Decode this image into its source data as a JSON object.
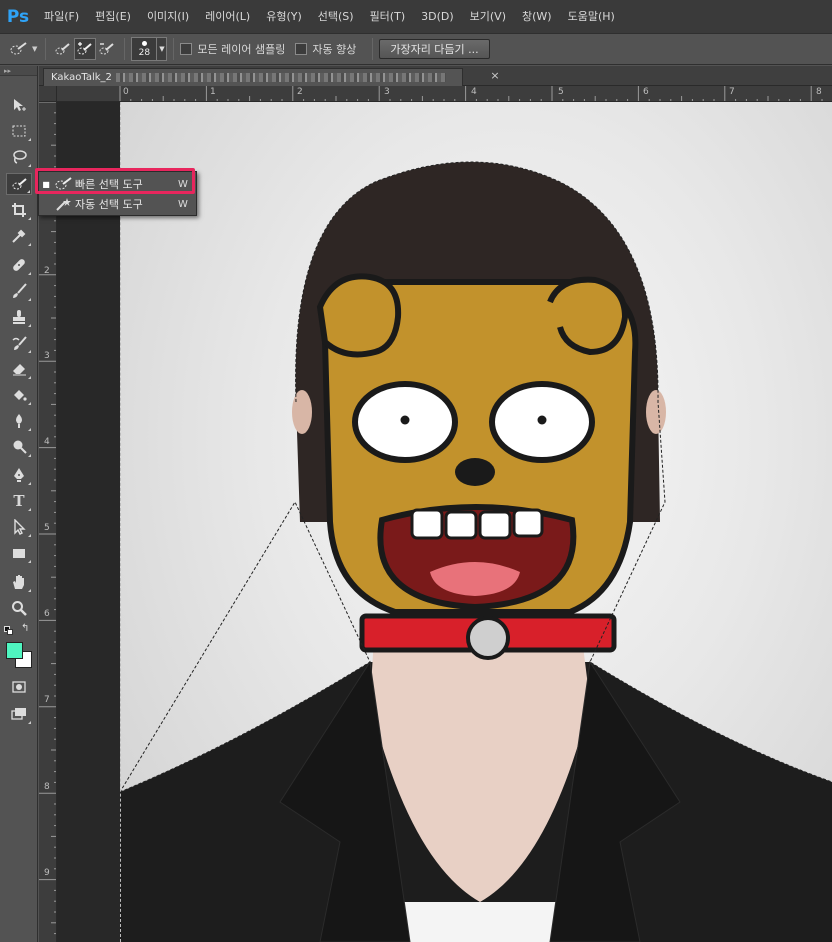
{
  "app": {
    "logo_text": "Ps"
  },
  "menu": [
    "파일(F)",
    "편집(E)",
    "이미지(I)",
    "레이어(L)",
    "유형(Y)",
    "선택(S)",
    "필터(T)",
    "3D(D)",
    "보기(V)",
    "창(W)",
    "도움말(H)"
  ],
  "options_bar": {
    "brush_size": "28",
    "sample_all_layers_label": "모든 레이어 샘플링",
    "sample_all_layers_checked": false,
    "auto_enhance_label": "자동 향상",
    "auto_enhance_checked": false,
    "refine_edge_label": "가장자리 다듬기 ..."
  },
  "document": {
    "tab_title": "KakaoTalk_2",
    "close_glyph": "×"
  },
  "rulers": {
    "horizontal": [
      "0",
      "1",
      "2",
      "3",
      "4",
      "5",
      "6",
      "7",
      "8"
    ],
    "vertical": [
      "2",
      "3",
      "4",
      "5",
      "6",
      "7",
      "8",
      "9"
    ]
  },
  "flyout": {
    "items": [
      {
        "label": "빠른 선택 도구",
        "shortcut": "W",
        "selected": true
      },
      {
        "label": "자동 선택 도구",
        "shortcut": "W",
        "selected": false
      }
    ],
    "selected_bullet": "■"
  },
  "colors": {
    "accent_highlight": "#e8265d",
    "foreground_color": "#4ff5c0",
    "background_color": "#ffffff",
    "ps_logo": "#2fa3f7"
  }
}
